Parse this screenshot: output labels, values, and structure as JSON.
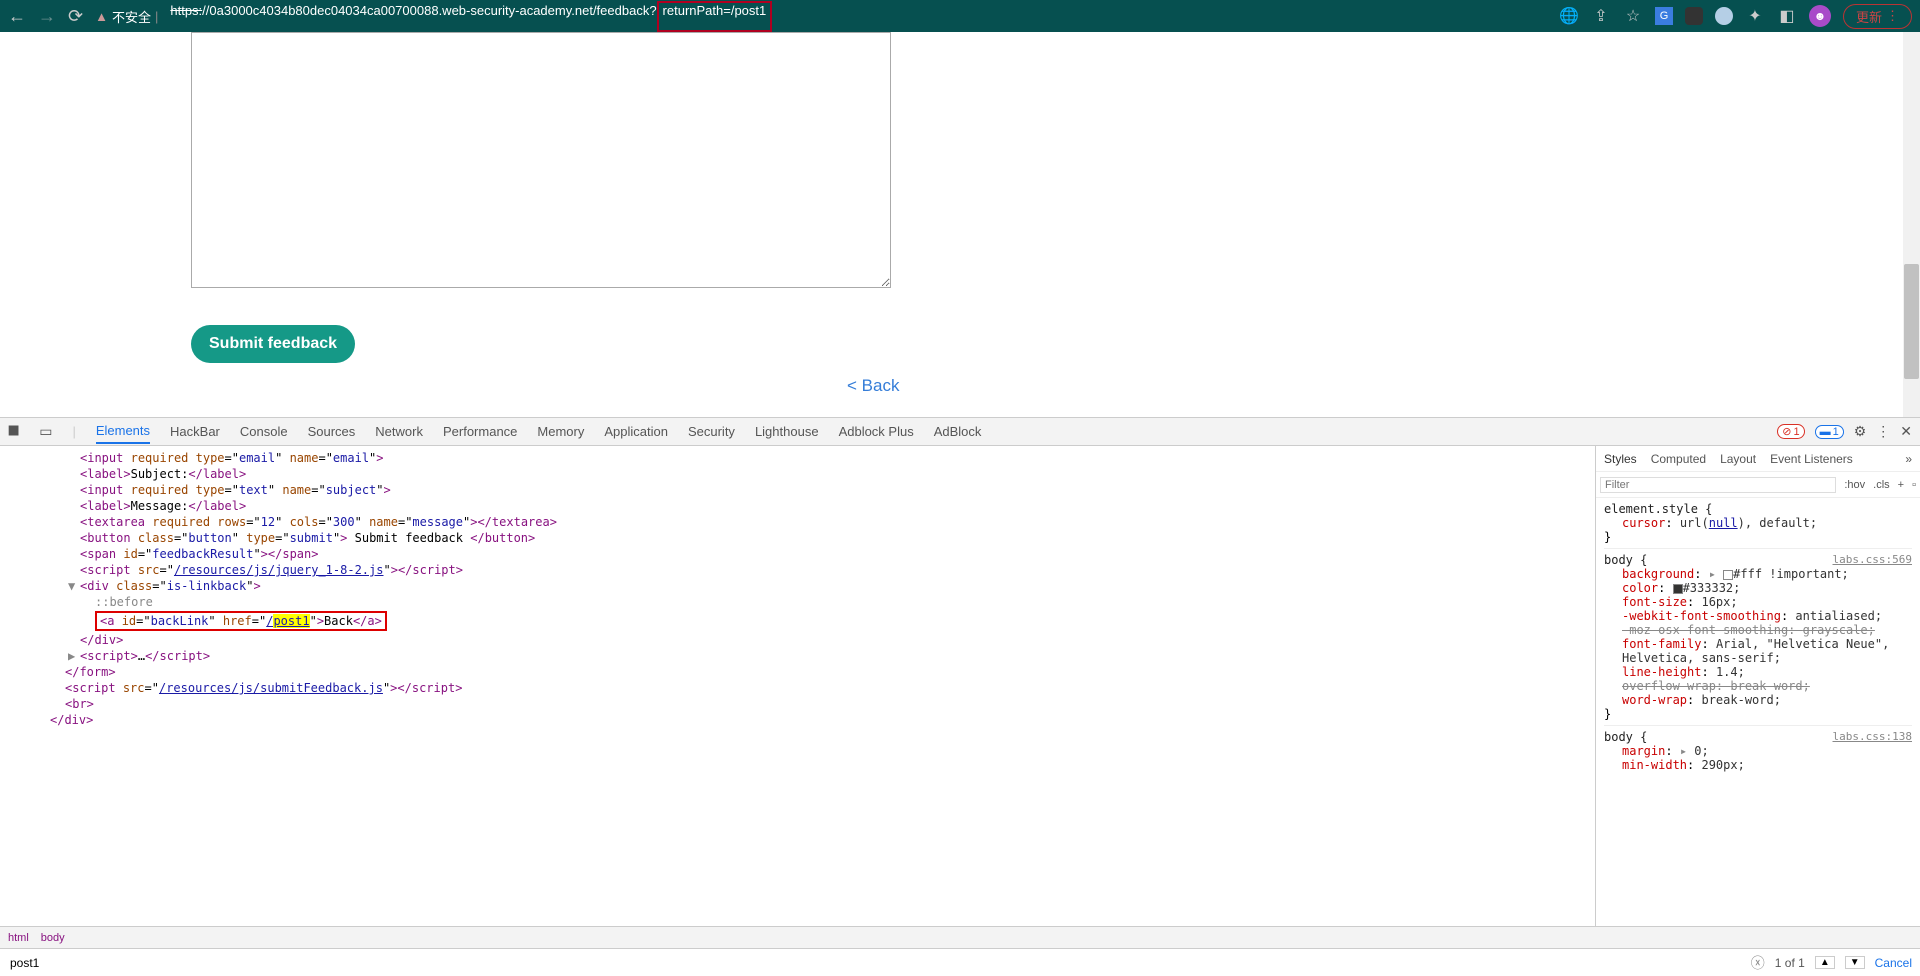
{
  "browser": {
    "security_label": "不安全",
    "url_struck": "https:",
    "url_main": "//0a3000c4034b80dec04034ca00700088.web-security-academy.net/feedback?",
    "url_highlight": "returnPath=/post1",
    "update_btn": "更新"
  },
  "page": {
    "submit_label": "Submit feedback",
    "back_label": "< Back"
  },
  "devtools": {
    "tabs": {
      "elements": "Elements",
      "hackbar": "HackBar",
      "console": "Console",
      "sources": "Sources",
      "network": "Network",
      "performance": "Performance",
      "memory": "Memory",
      "application": "Application",
      "security": "Security",
      "lighthouse": "Lighthouse",
      "adblockplus": "Adblock Plus",
      "adblock": "AdBlock"
    },
    "error_count": "1",
    "info_count": "1",
    "elements_tree": {
      "l1_input_email": {
        "tag": "input",
        "required": "required",
        "type": "email",
        "name": "email"
      },
      "l2_label_subject": {
        "tag": "label",
        "text": "Subject:"
      },
      "l3_input_subject": {
        "tag": "input",
        "required": "required",
        "type": "text",
        "name": "subject"
      },
      "l4_label_message": {
        "tag": "label",
        "text": "Message:"
      },
      "l5_textarea": {
        "tag": "textarea",
        "required": "required",
        "rows": "12",
        "cols": "300",
        "name": "message"
      },
      "l6_button": {
        "tag": "button",
        "class": "button",
        "type": "submit",
        "text": " Submit feedback "
      },
      "l7_span": {
        "tag": "span",
        "id": "feedbackResult"
      },
      "l8_script": {
        "tag": "script",
        "src": "/resources/js/jquery_1-8-2.js"
      },
      "l9_div": {
        "tag": "div",
        "class": "is-linkback"
      },
      "l10_before": "::before",
      "l11_a": {
        "tag": "a",
        "id": "backLink",
        "href_pre": "/",
        "href_hl": "post1",
        "text": "Back"
      },
      "l12_divclose": "</div>",
      "l13_script": {
        "tag": "script",
        "text": "…"
      },
      "l14_formclose": "</form>",
      "l15_script": {
        "tag": "script",
        "src": "/resources/js/submitFeedback.js"
      },
      "l16_br": "<br>",
      "l17_divclose": "</div>"
    },
    "breadcrumb": {
      "html": "html",
      "body": "body"
    },
    "search": {
      "value": "post1",
      "count": "1 of 1",
      "cancel": "Cancel"
    },
    "styles": {
      "tabs": {
        "styles": "Styles",
        "computed": "Computed",
        "layout": "Layout",
        "events": "Event Listeners"
      },
      "filter_placeholder": "Filter",
      "hov": ":hov",
      "cls": ".cls",
      "element_style": "element.style {",
      "cursor_prop": "cursor",
      "cursor_val_url": "url(",
      "cursor_val_null": "null",
      "cursor_val_rest": "), default;",
      "brace_close": "}",
      "body_sel": "body {",
      "src1": "labs.css:569",
      "background_prop": "background",
      "background_val": "#fff !important;",
      "color_prop": "color",
      "color_val": "#333332;",
      "fontsize_prop": "font-size",
      "fontsize_val": "16px;",
      "webkit_prop": "-webkit-font-smoothing",
      "webkit_val": "antialiased;",
      "moz_prop": "-moz-osx-font-smoothing",
      "moz_val": "grayscale;",
      "fontfam_prop": "font-family",
      "fontfam_val": "Arial, \"Helvetica Neue\", Helvetica, sans-serif;",
      "lineheight_prop": "line-height",
      "lineheight_val": "1.4;",
      "overflow_prop": "overflow-wrap",
      "overflow_val": "break-word;",
      "wordwrap_prop": "word-wrap",
      "wordwrap_val": "break-word;",
      "src2": "labs.css:138",
      "margin_prop": "margin",
      "margin_val": "0;",
      "minwidth_prop": "min-width",
      "minwidth_val": "290px;"
    }
  }
}
